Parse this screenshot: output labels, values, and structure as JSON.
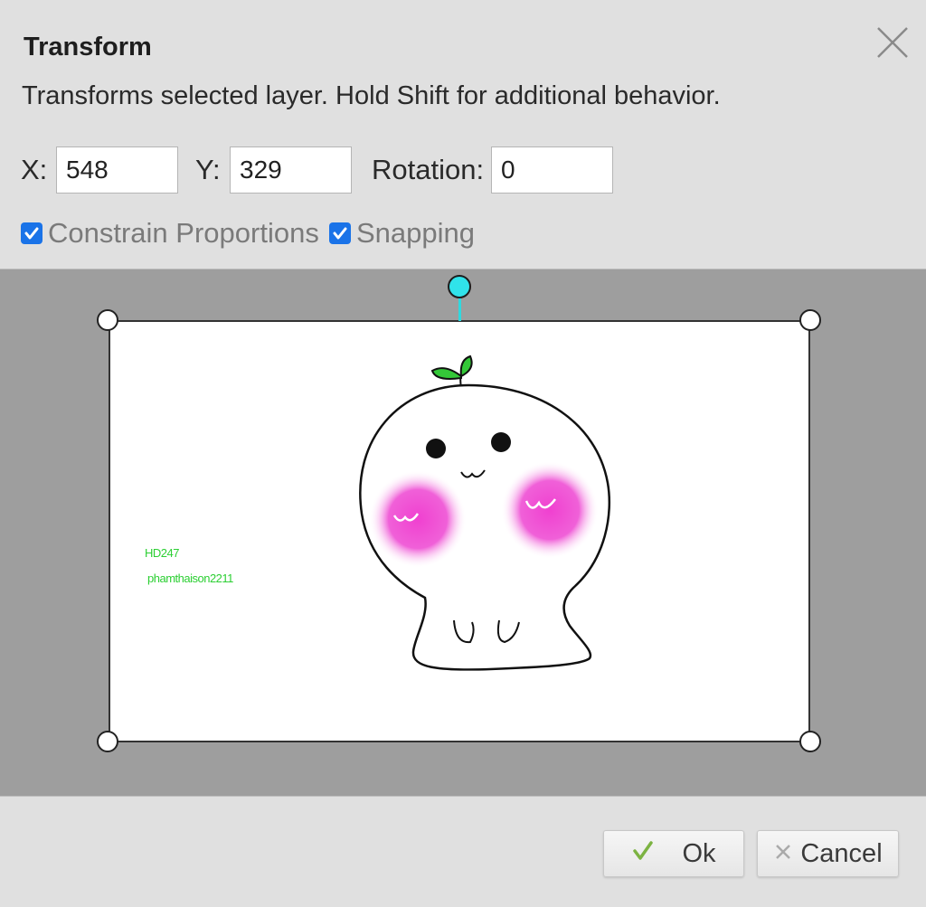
{
  "dialog": {
    "title": "Transform",
    "description": "Transforms selected layer. Hold Shift for additional behavior.",
    "close_icon": "close-icon"
  },
  "fields": {
    "x_label": "X:",
    "x_value": "548",
    "y_label": "Y:",
    "y_value": "329",
    "rotation_label": "Rotation:",
    "rotation_value": "0"
  },
  "options": {
    "constrain_label": "Constrain Proportions",
    "constrain_checked": true,
    "snapping_label": "Snapping",
    "snapping_checked": true
  },
  "preview": {
    "watermark_line1": "HD247",
    "watermark_line2": "phamthaison2211",
    "rotation_handle_color": "#30e3ea",
    "watermark_color": "#2ccf33"
  },
  "buttons": {
    "ok_label": "Ok",
    "ok_icon": "checkmark-icon",
    "cancel_label": "Cancel",
    "cancel_icon": "x-icon"
  },
  "colors": {
    "accent": "#1a73e8",
    "dialog_bg": "#e0e0e0",
    "canvas_bg": "#9e9e9e",
    "cheek_pink": "#f050d0"
  }
}
